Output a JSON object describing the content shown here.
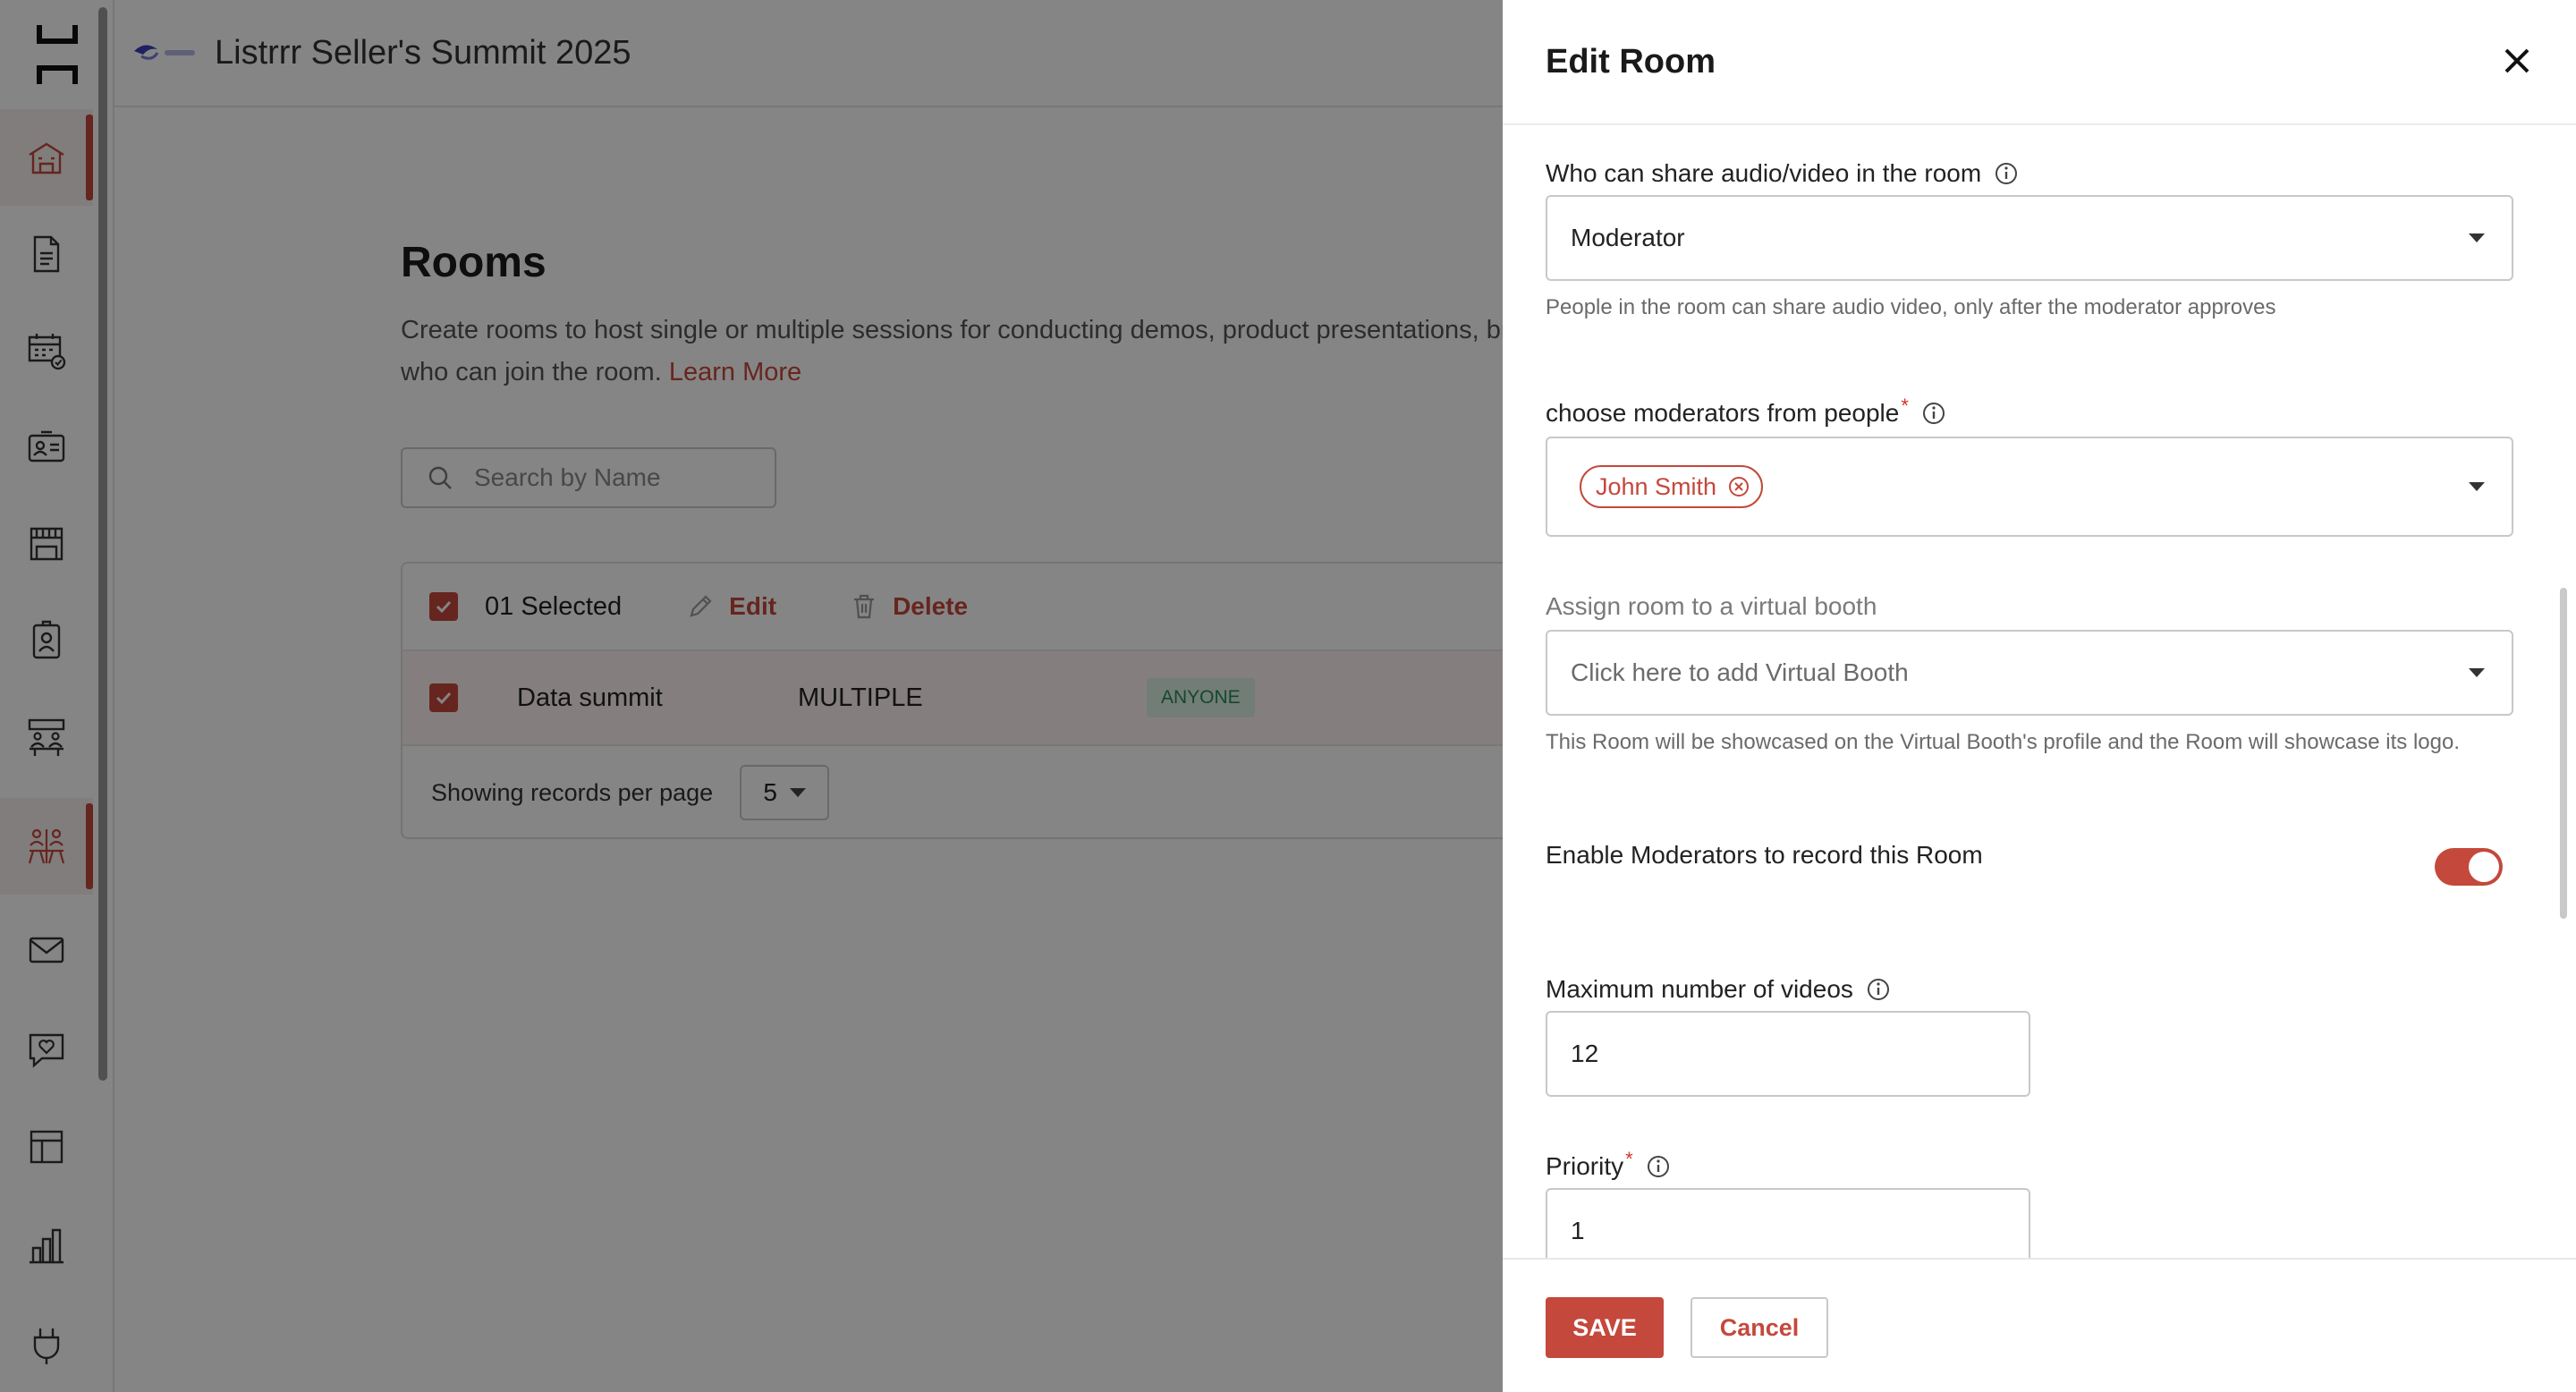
{
  "app": {
    "event_title": "Listrrr Seller's Summit 2025",
    "logo_icon": "hubilo-logo-icon",
    "event_logo_icon": "event-logo-icon"
  },
  "sidebar": {
    "items": [
      {
        "icon": "building-icon",
        "active": true
      },
      {
        "icon": "document-icon",
        "active": false
      },
      {
        "icon": "calendar-check-icon",
        "active": false
      },
      {
        "icon": "id-card-icon",
        "active": false
      },
      {
        "icon": "storefront-icon",
        "active": false
      },
      {
        "icon": "badge-icon",
        "active": false
      },
      {
        "icon": "meeting-table-icon",
        "active": false
      },
      {
        "icon": "networking-icon",
        "active": true
      },
      {
        "icon": "mail-icon",
        "active": false
      },
      {
        "icon": "chat-heart-icon",
        "active": false
      },
      {
        "icon": "layout-icon",
        "active": false
      },
      {
        "icon": "bar-chart-icon",
        "active": false
      },
      {
        "icon": "plug-icon",
        "active": false
      }
    ]
  },
  "page": {
    "title": "Rooms",
    "description_line1": "Create rooms to host single or multiple sessions for conducting demos, product presentations, bre",
    "description_line2": "who can join the room.",
    "learn_more": "Learn More",
    "search_placeholder": "Search by Name"
  },
  "table": {
    "selected_label": "01 Selected",
    "edit_label": "Edit",
    "delete_label": "Delete",
    "rows": [
      {
        "name": "Data summit",
        "type": "MULTIPLE",
        "access": "ANYONE",
        "checked": true
      }
    ],
    "per_page_label": "Showing records per page",
    "per_page_value": "5"
  },
  "drawer": {
    "title": "Edit Room",
    "share_label": "Who can share audio/video in the room",
    "share_value": "Moderator",
    "share_help": "People in the room can share audio video, only after the moderator approves",
    "moderators_label": "choose moderators from people",
    "moderators_required": "*",
    "moderator_chip": "John Smith",
    "booth_label": "Assign room to a virtual booth",
    "booth_placeholder": "Click here to add Virtual Booth",
    "booth_help": "This Room will be showcased on the Virtual Booth's profile and the Room will showcase its logo.",
    "record_label": "Enable Moderators to record this Room",
    "record_enabled": true,
    "max_videos_label": "Maximum number of videos",
    "max_videos_value": "12",
    "priority_label": "Priority",
    "priority_required": "*",
    "priority_value": "1",
    "save_label": "SAVE",
    "cancel_label": "Cancel"
  },
  "colors": {
    "accent": "#c4483c",
    "overlay": "rgba(0,0,0,0.48)",
    "badge_bg": "#d9efe2",
    "badge_text": "#2a8a5a"
  }
}
